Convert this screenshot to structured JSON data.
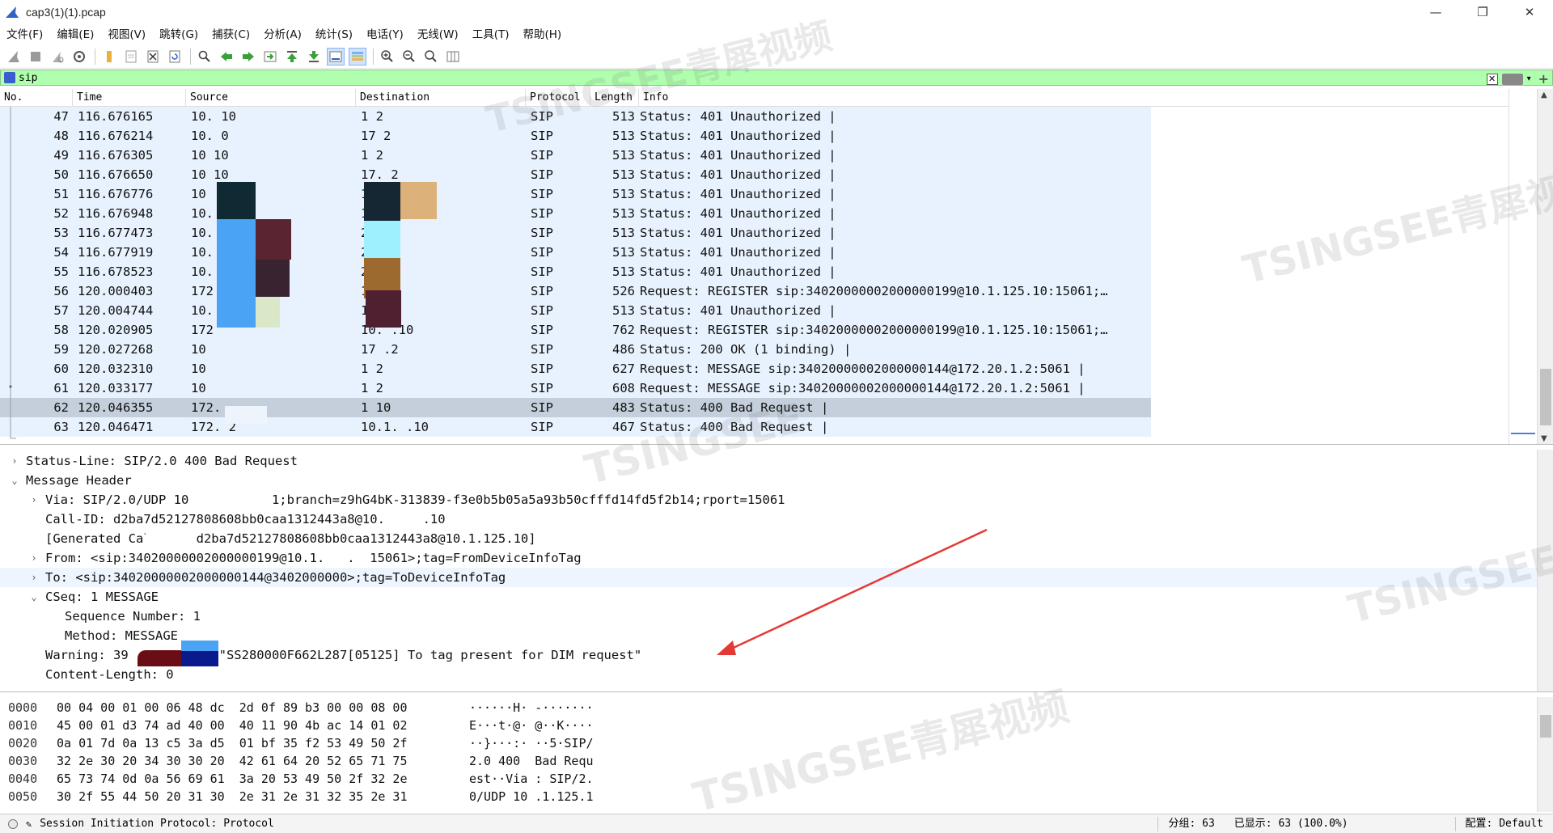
{
  "window": {
    "title": "cap3(1)(1).pcap",
    "controls": [
      "—",
      "❐",
      "✕"
    ]
  },
  "menu": [
    "文件(F)",
    "编辑(E)",
    "视图(V)",
    "跳转(G)",
    "捕获(C)",
    "分析(A)",
    "统计(S)",
    "电话(Y)",
    "无线(W)",
    "工具(T)",
    "帮助(H)"
  ],
  "toolbar_icons": [
    "shark-fin-start-icon",
    "stop-capture-icon",
    "restart-capture-icon",
    "capture-options-icon",
    "open-file-icon",
    "save-file-icon",
    "close-file-icon",
    "reload-file-icon",
    "find-packet-icon",
    "go-back-icon",
    "go-forward-icon",
    "go-to-packet-icon",
    "go-first-icon",
    "go-last-icon",
    "auto-scroll-icon",
    "colorize-icon",
    "zoom-in-icon",
    "zoom-out-icon",
    "normal-size-icon",
    "resize-columns-icon"
  ],
  "filter": {
    "value": "sip"
  },
  "packet_list": {
    "columns": [
      "No.",
      "Time",
      "Source",
      "Destination",
      "Protocol",
      "Length",
      "Info"
    ],
    "rows": [
      {
        "no": "47",
        "time": "116.676165",
        "src": "10.     10",
        "dst": "1        2",
        "proto": "SIP",
        "len": "513",
        "info": "Status: 401 Unauthorized |"
      },
      {
        "no": "48",
        "time": "116.676214",
        "src": "10.      0",
        "dst": "17       2",
        "proto": "SIP",
        "len": "513",
        "info": "Status: 401 Unauthorized |"
      },
      {
        "no": "49",
        "time": "116.676305",
        "src": "10       10",
        "dst": "1        2",
        "proto": "SIP",
        "len": "513",
        "info": "Status: 401 Unauthorized |"
      },
      {
        "no": "50",
        "time": "116.676650",
        "src": "10       10",
        "dst": "17.      2",
        "proto": "SIP",
        "len": "513",
        "info": "Status: 401 Unauthorized |"
      },
      {
        "no": "51",
        "time": "116.676776",
        "src": "10",
        "dst": "172      2",
        "proto": "SIP",
        "len": "513",
        "info": "Status: 401 Unauthorized |"
      },
      {
        "no": "52",
        "time": "116.676948",
        "src": "10.",
        "dst": "1",
        "proto": "SIP",
        "len": "513",
        "info": "Status: 401 Unauthorized |"
      },
      {
        "no": "53",
        "time": "116.677473",
        "src": "10.",
        "dst": "         2",
        "proto": "SIP",
        "len": "513",
        "info": "Status: 401 Unauthorized |"
      },
      {
        "no": "54",
        "time": "116.677919",
        "src": "10.",
        "dst": "         2",
        "proto": "SIP",
        "len": "513",
        "info": "Status: 401 Unauthorized |"
      },
      {
        "no": "55",
        "time": "116.678523",
        "src": "10.",
        "dst": "         2",
        "proto": "SIP",
        "len": "513",
        "info": "Status: 401 Unauthorized |"
      },
      {
        "no": "56",
        "time": "120.000403",
        "src": "172",
        "dst": "1       .10",
        "proto": "SIP",
        "len": "526",
        "info": "Request: REGISTER sip:34020000002000000199@10.1.125.10:15061;…"
      },
      {
        "no": "57",
        "time": "120.004744",
        "src": "10.      0",
        "dst": "17      .2",
        "proto": "SIP",
        "len": "513",
        "info": "Status: 401 Unauthorized |"
      },
      {
        "no": "58",
        "time": "120.020905",
        "src": "172",
        "dst": "10.     .10",
        "proto": "SIP",
        "len": "762",
        "info": "Request: REGISTER sip:34020000002000000199@10.1.125.10:15061;…"
      },
      {
        "no": "59",
        "time": "120.027268",
        "src": "10",
        "dst": "17      .2",
        "proto": "SIP",
        "len": "486",
        "info": "Status: 200 OK  (1 binding) |"
      },
      {
        "no": "60",
        "time": "120.032310",
        "src": "10",
        "dst": "1        2",
        "proto": "SIP",
        "len": "627",
        "info": "Request: MESSAGE sip:34020000002000000144@172.20.1.2:5061 |"
      },
      {
        "no": "61",
        "time": "120.033177",
        "src": "10",
        "dst": "1        2",
        "proto": "SIP",
        "len": "608",
        "info": "Request: MESSAGE sip:34020000002000000144@172.20.1.2:5061 |"
      },
      {
        "no": "62",
        "time": "120.046355",
        "src": "172.",
        "dst": "1       10",
        "proto": "SIP",
        "len": "483",
        "info": "Status: 400 Bad Request |"
      },
      {
        "no": "63",
        "time": "120.046471",
        "src": "172.     2",
        "dst": "10.1.   .10",
        "proto": "SIP",
        "len": "467",
        "info": "Status: 400 Bad Request |"
      }
    ]
  },
  "details": [
    {
      "indent": 1,
      "arrow": "›",
      "text": "Status-Line: SIP/2.0 400 Bad Request"
    },
    {
      "indent": 1,
      "arrow": "⌄",
      "text": "Message Header"
    },
    {
      "indent": 2,
      "arrow": "›",
      "text": "Via: SIP/2.0/UDP 10           1;branch=z9hG4bK-313839-f3e0b5b05a5a93b50cfffd14fd5f2b14;rport=15061"
    },
    {
      "indent": 2,
      "arrow": "",
      "text": "Call-ID: d2ba7d52127808608bb0caa1312443a8@10.     .10"
    },
    {
      "indent": 2,
      "arrow": "",
      "text": "[Generated Call-ID: d2ba7d52127808608bb0caa1312443a8@10.1.125.10]"
    },
    {
      "indent": 2,
      "arrow": "›",
      "text": "From: <sip:34020000002000000199@10.1.   .  15061>;tag=FromDeviceInfoTag"
    },
    {
      "indent": 2,
      "arrow": "›",
      "text": "To: <sip:34020000002000000144@3402000000>;tag=ToDeviceInfoTag"
    },
    {
      "indent": 2,
      "arrow": "⌄",
      "text": "CSeq: 1 MESSAGE"
    },
    {
      "indent": 3,
      "arrow": "",
      "text": "Sequence Number: 1"
    },
    {
      "indent": 3,
      "arrow": "",
      "text": "Method: MESSAGE"
    },
    {
      "indent": 2,
      "arrow": "",
      "text": "Warning: 39         .1 \"SS280000F662L287[05125] To tag present for DIM request\""
    },
    {
      "indent": 2,
      "arrow": "",
      "text": "Content-Length: 0"
    }
  ],
  "hex": [
    {
      "off": "0000",
      "bytes": "00 04 00 01 00 06 48 dc  2d 0f 89 b3 00 00 08 00",
      "ascii": "······H· -·······"
    },
    {
      "off": "0010",
      "bytes": "45 00 01 d3 74 ad 40 00  40 11 90 4b ac 14 01 02",
      "ascii": "E···t·@· @··K····"
    },
    {
      "off": "0020",
      "bytes": "0a 01 7d 0a 13 c5 3a d5  01 bf 35 f2 53 49 50 2f",
      "ascii": "··}···:· ··5·SIP/"
    },
    {
      "off": "0030",
      "bytes": "32 2e 30 20 34 30 30 20  42 61 64 20 52 65 71 75",
      "ascii": "2.0 400  Bad Requ"
    },
    {
      "off": "0040",
      "bytes": "65 73 74 0d 0a 56 69 61  3a 20 53 49 50 2f 32 2e",
      "ascii": "est··Via : SIP/2."
    },
    {
      "off": "0050",
      "bytes": "30 2f 55 44 50 20 31 30  2e 31 2e 31 32 35 2e 31",
      "ascii": "0/UDP 10 .1.125.1"
    }
  ],
  "status": {
    "left": "Session Initiation Protocol: Protocol",
    "packets": "分组: 63",
    "displayed": "已显示: 63 (100.0%)",
    "profile": "配置: Default"
  },
  "watermarks": [
    "TSINGSEE青犀视频",
    "TSINGSEE青犀视频",
    "TSINGSEE",
    "TSINGSEE青犀视频",
    "TSINGSEE青犀视频"
  ],
  "colors": {
    "filter_valid_bg": "#afffaf",
    "row_bg": "#e8f2fe",
    "row_selected_bg": "#c4cfdb",
    "annotation_arrow": "#e53935"
  }
}
